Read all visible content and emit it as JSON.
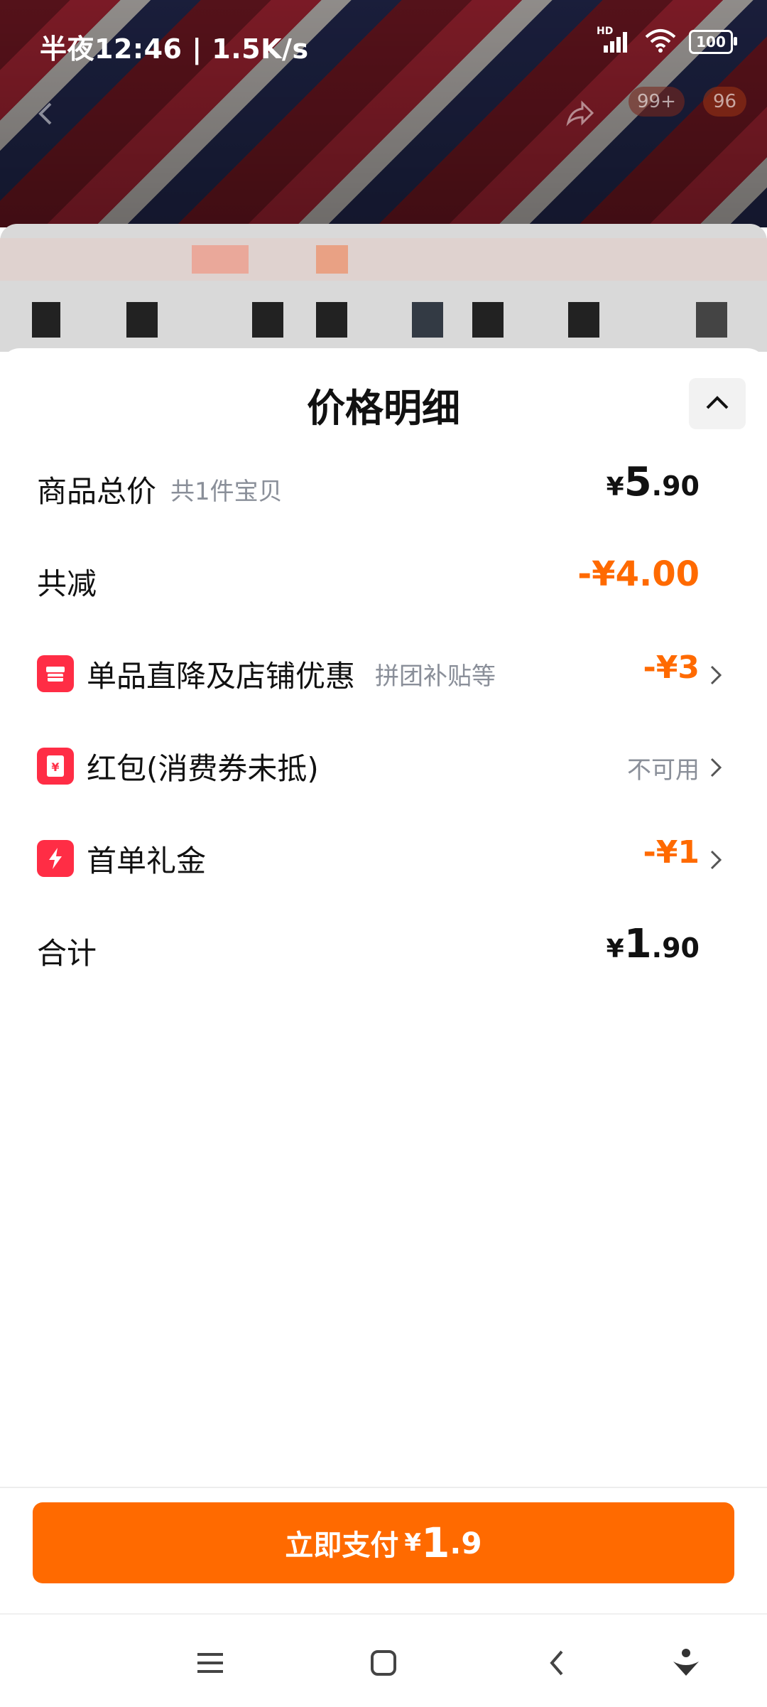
{
  "status_bar": {
    "time": "半夜12:46 | 1.5K/s",
    "network": "HD",
    "battery": "100"
  },
  "background": {
    "cart_badge": "99+",
    "count_badge": "96"
  },
  "sheet": {
    "title": "价格明细",
    "collapse_icon": "chevron-up-icon"
  },
  "rows": {
    "subtotal": {
      "label": "商品总价",
      "sublabel": "共1件宝贝",
      "currency": "¥",
      "int": "5",
      "dec": ".90"
    },
    "discount_total": {
      "label": "共减",
      "value": "-¥4.00"
    },
    "store_discount": {
      "label": "单品直降及店铺优惠",
      "sublabel": "拼团补贴等",
      "value": "-¥3"
    },
    "red_packet": {
      "label": "红包(消费券未抵)",
      "value": "不可用"
    },
    "first_order_gift": {
      "label": "首单礼金",
      "value": "-¥1"
    },
    "total": {
      "label": "合计",
      "currency": "¥",
      "int": "1",
      "dec": ".90"
    }
  },
  "pay_button": {
    "label": "立即支付",
    "currency": "¥",
    "int": "1",
    "dec": ".9"
  },
  "colors": {
    "accent": "#ff6a00",
    "badge_red": "#ff2d45",
    "muted": "#8a8f99"
  },
  "nav": {
    "icons": [
      "menu-icon",
      "home-square-icon",
      "back-icon",
      "assistant-icon"
    ]
  }
}
